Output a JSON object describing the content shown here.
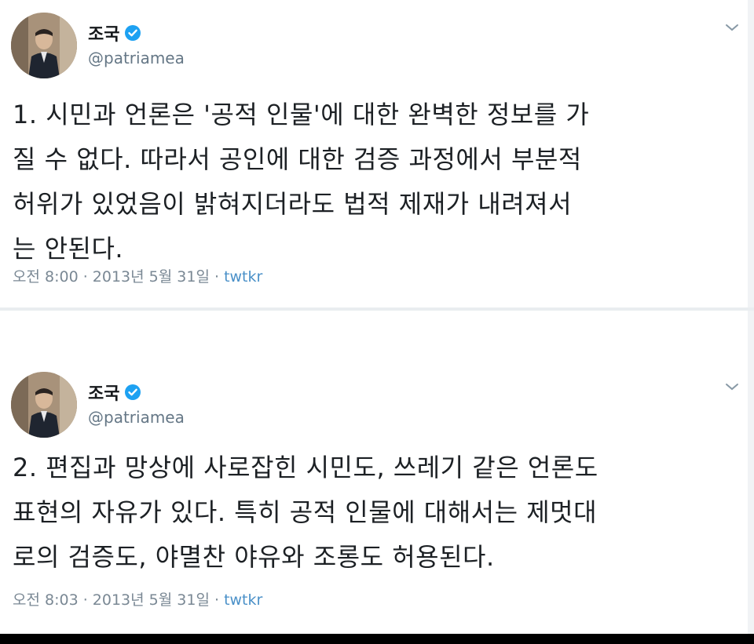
{
  "tweets": [
    {
      "author_name": "조국",
      "handle": "@patriamea",
      "text": "1. 시민과 언론은 '공적 인물'에 대한 완벽한 정보를 가\n질 수 없다. 따라서 공인에 대한 검증 과정에서 부분적\n허위가 있었음이 밝혀지더라도 법적 제재가 내려져서\n는 안된다.",
      "time": "오전 8:00",
      "date": "2013년 5월 31일",
      "source": "twtkr"
    },
    {
      "author_name": "조국",
      "handle": "@patriamea",
      "text": "2. 편집과 망상에 사로잡힌 시민도, 쓰레기 같은 언론도\n표현의 자유가 있다. 특히 공적 인물에 대해서는 제멋대\n로의 검증도, 야멸찬 야유와 조롱도 허용된다.",
      "time": "오전 8:03",
      "date": "2013년 5월 31일",
      "source": "twtkr"
    }
  ],
  "meta_separator": " · ",
  "icons": {
    "verified": "verified-badge-icon",
    "menu": "chevron-down-icon"
  },
  "colors": {
    "verified": "#1da1f2",
    "handle": "#657786",
    "source": "#4a90c8"
  }
}
